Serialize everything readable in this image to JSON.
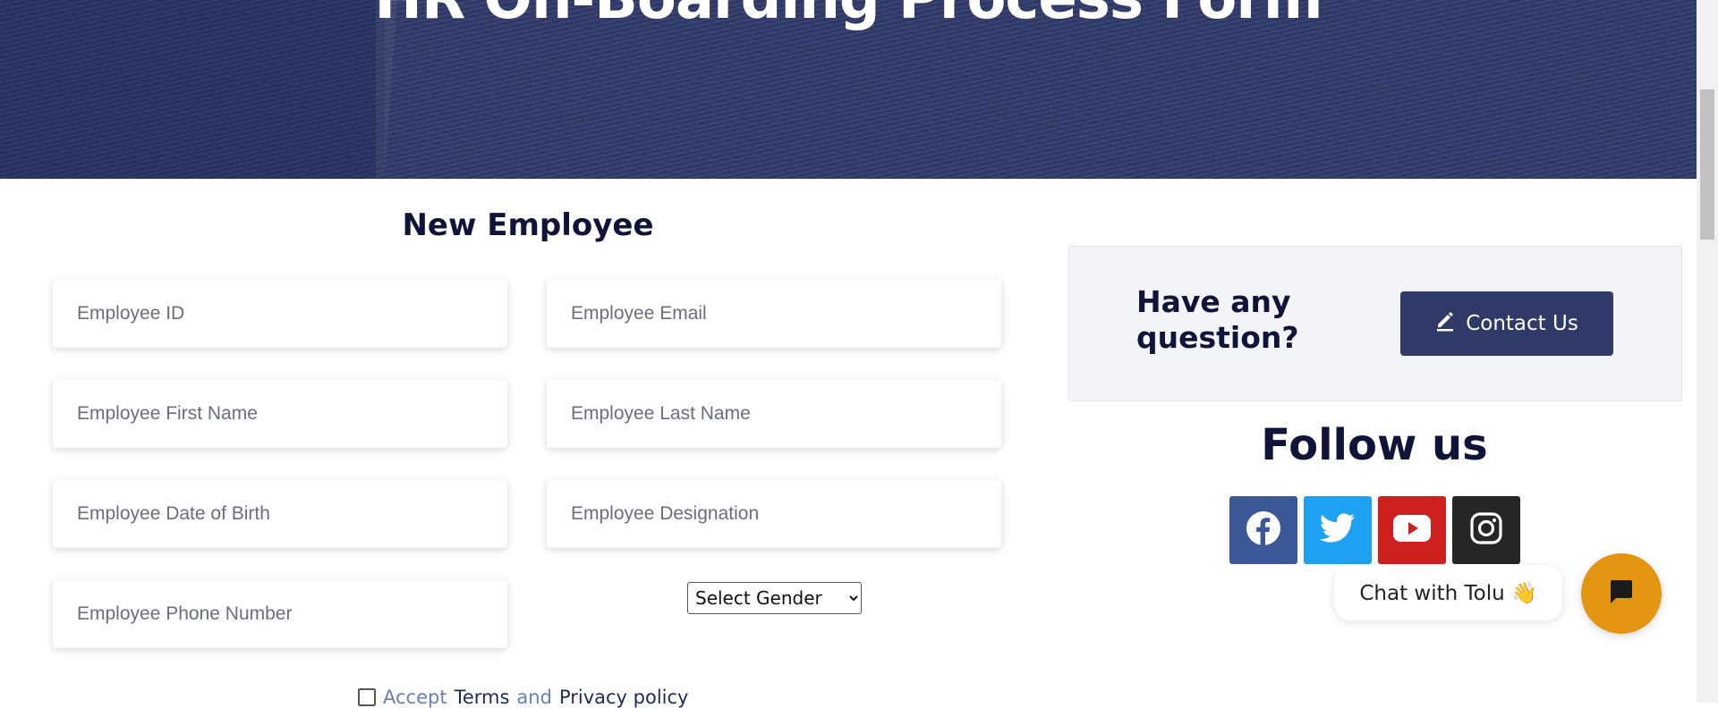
{
  "hero": {
    "title": "HR On-Boarding Process Form"
  },
  "form": {
    "title": "New Employee",
    "fields": {
      "employee_id": "Employee ID",
      "employee_email": "Employee Email",
      "first_name": "Employee First Name",
      "last_name": "Employee Last Name",
      "date_of_birth": "Employee Date of Birth",
      "designation": "Employee Designation",
      "phone_number": "Employee Phone Number"
    },
    "gender_select": {
      "selected": "Select Gender"
    },
    "terms": {
      "prefix": "Accept",
      "terms_link": "Terms",
      "and": "and",
      "privacy_link": "Privacy policy",
      "checked": false
    }
  },
  "sidebar": {
    "question": "Have any question?",
    "contact_button": "Contact Us",
    "follow_title": "Follow us",
    "social": [
      {
        "name": "facebook",
        "icon": "facebook-icon",
        "color": "#3b5998"
      },
      {
        "name": "twitter",
        "icon": "twitter-icon",
        "color": "#1da1f2"
      },
      {
        "name": "youtube",
        "icon": "youtube-icon",
        "color": "#cd201f"
      },
      {
        "name": "instagram",
        "icon": "instagram-icon",
        "color": "#262626"
      }
    ]
  },
  "chat": {
    "bubble_text": "Chat with Tolu 👋",
    "button_icon": "chat-icon",
    "button_color": "#e39410"
  },
  "colors": {
    "brand": "#2f3a68",
    "heading": "#0f1438"
  }
}
